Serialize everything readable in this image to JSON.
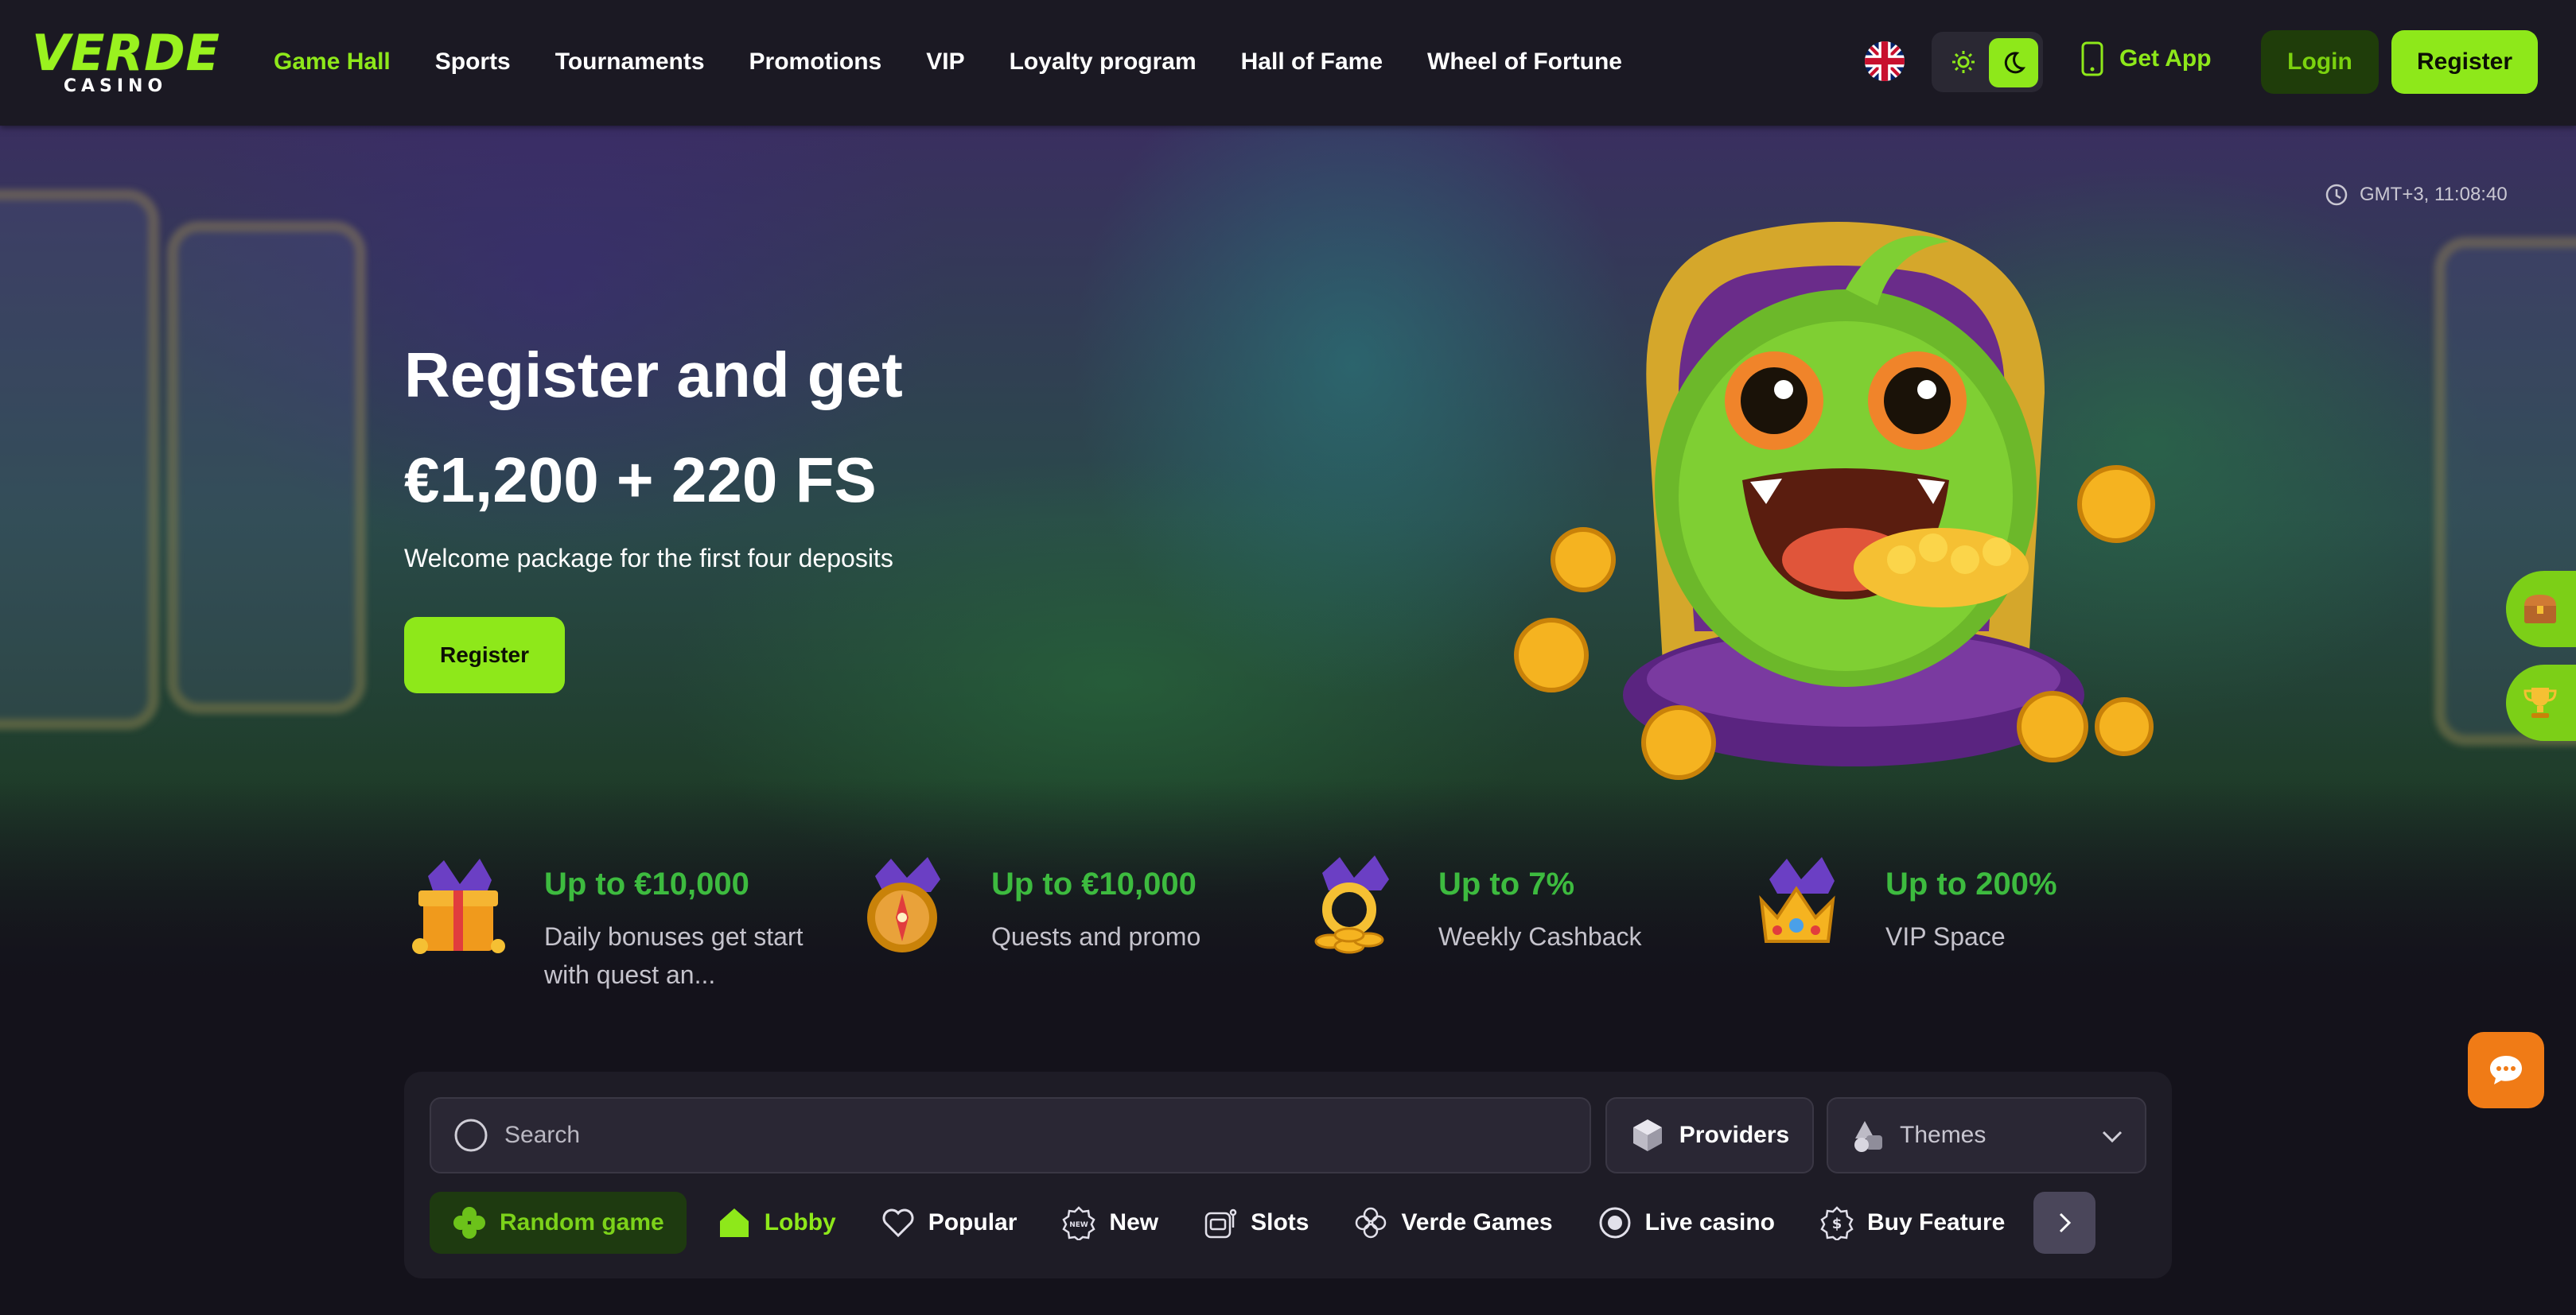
{
  "brand": {
    "name": "VERDE",
    "sub": "CASINO",
    "accent": "#8ee81a"
  },
  "nav": [
    {
      "label": "Game Hall",
      "active": true
    },
    {
      "label": "Sports"
    },
    {
      "label": "Tournaments"
    },
    {
      "label": "Promotions"
    },
    {
      "label": "VIP"
    },
    {
      "label": "Loyalty program"
    },
    {
      "label": "Hall of Fame"
    },
    {
      "label": "Wheel of Fortune"
    }
  ],
  "header": {
    "language_icon": "uk-flag-icon",
    "get_app": "Get App",
    "login": "Login",
    "register": "Register"
  },
  "hero": {
    "clock": "GMT+3,  11:08:40",
    "title_line1": "Register and get",
    "title_line2": "€1,200 + 220 FS",
    "subtitle": "Welcome package for the first four deposits",
    "cta": "Register"
  },
  "features": [
    {
      "title": "Up to €10,000",
      "subtitle": "Daily bonuses get start with quest an...",
      "icon": "gift-icon"
    },
    {
      "title": "Up to €10,000",
      "subtitle": "Quests and promo",
      "icon": "compass-icon"
    },
    {
      "title": "Up to 7%",
      "subtitle": "Weekly Cashback",
      "icon": "coins-icon"
    },
    {
      "title": "Up to 200%",
      "subtitle": "VIP Space",
      "icon": "crown-icon"
    }
  ],
  "games": {
    "search_placeholder": "Search",
    "providers": "Providers",
    "themes": "Themes",
    "categories": [
      {
        "label": "Random game",
        "icon": "clover-icon"
      },
      {
        "label": "Lobby",
        "icon": "home-icon"
      },
      {
        "label": "Popular",
        "icon": "heart-icon"
      },
      {
        "label": "New",
        "icon": "new-badge-icon"
      },
      {
        "label": "Slots",
        "icon": "slot-icon"
      },
      {
        "label": "Verde Games",
        "icon": "verde-icon"
      },
      {
        "label": "Live casino",
        "icon": "live-icon"
      },
      {
        "label": "Buy Feature",
        "icon": "dollar-icon"
      }
    ]
  }
}
